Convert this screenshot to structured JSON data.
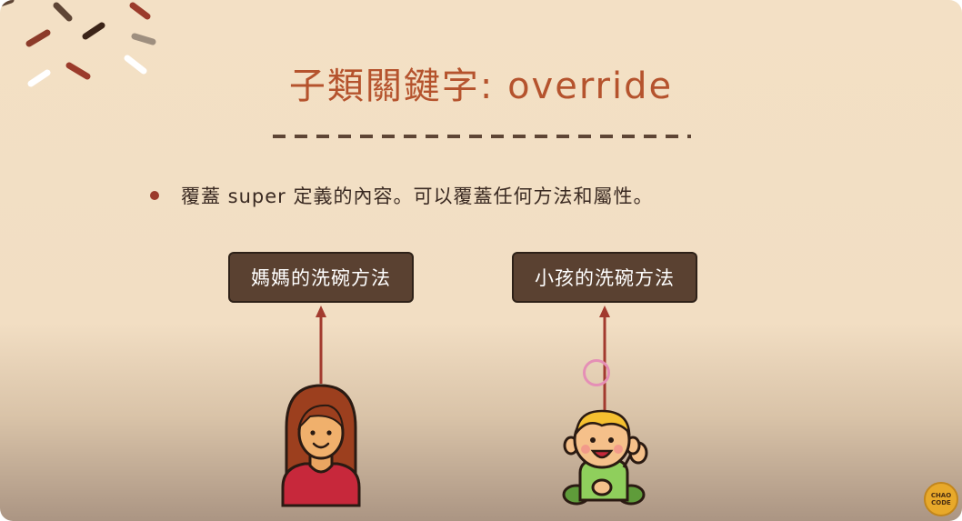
{
  "slide": {
    "title": "子類關鍵字: override",
    "bullet": "覆蓋 super 定義的內容。可以覆蓋任何方法和屬性。",
    "mom_box_label": "媽媽的洗碗方法",
    "kid_box_label": "小孩的洗碗方法"
  },
  "logo": {
    "line1": "CHAO",
    "line2": "CODE"
  },
  "colors": {
    "background": "#f3e0c5",
    "title": "#b5532d",
    "box_fill": "#5a4131",
    "arrow": "#a23a2e",
    "click_ring": "#e58fb6",
    "logo": "#e8a92a"
  },
  "icons": {
    "mom": "woman-icon",
    "kid": "baby-icon",
    "decor": "sprinkles-icon"
  }
}
